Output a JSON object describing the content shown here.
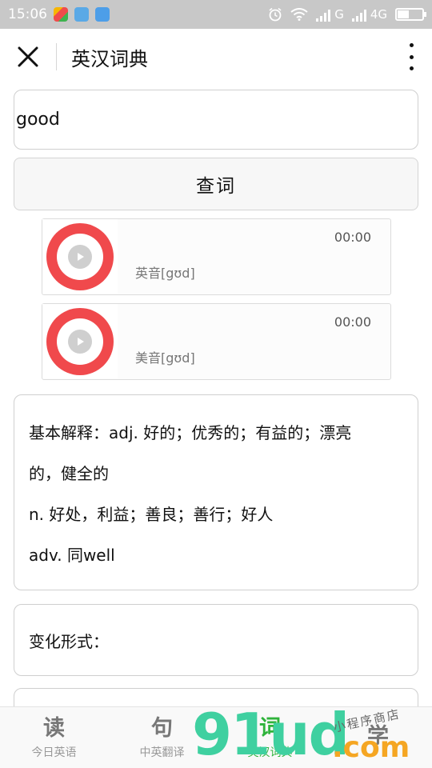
{
  "status_bar": {
    "time": "15:06",
    "network_g": "G",
    "network_4g": "4G",
    "battery_level": 0.45
  },
  "header": {
    "title": "英汉词典"
  },
  "search": {
    "value": "good",
    "button_label": "查词"
  },
  "audio": {
    "uk": {
      "time": "00:00",
      "label": "英音[gʊd]"
    },
    "us": {
      "time": "00:00",
      "label": "美音[gʊd]"
    }
  },
  "definition": {
    "line1": "基本解释：adj. 好的；优秀的；有益的；漂亮",
    "line2": "的，健全的",
    "line3": "n. 好处，利益；善良；善行；好人",
    "line4": "adv. 同well"
  },
  "variants": {
    "label": "变化形式："
  },
  "tabs": [
    {
      "icon": "读",
      "label": "今日英语"
    },
    {
      "icon": "句",
      "label": "中英翻译"
    },
    {
      "icon": "词",
      "label": "英汉词典"
    },
    {
      "icon": "学",
      "label": ""
    }
  ],
  "watermark": {
    "big": "91ud",
    "com": ".com",
    "small": "小程序商店"
  },
  "colors": {
    "accent_green": "#2fb33b",
    "play_red": "#f0494c"
  }
}
